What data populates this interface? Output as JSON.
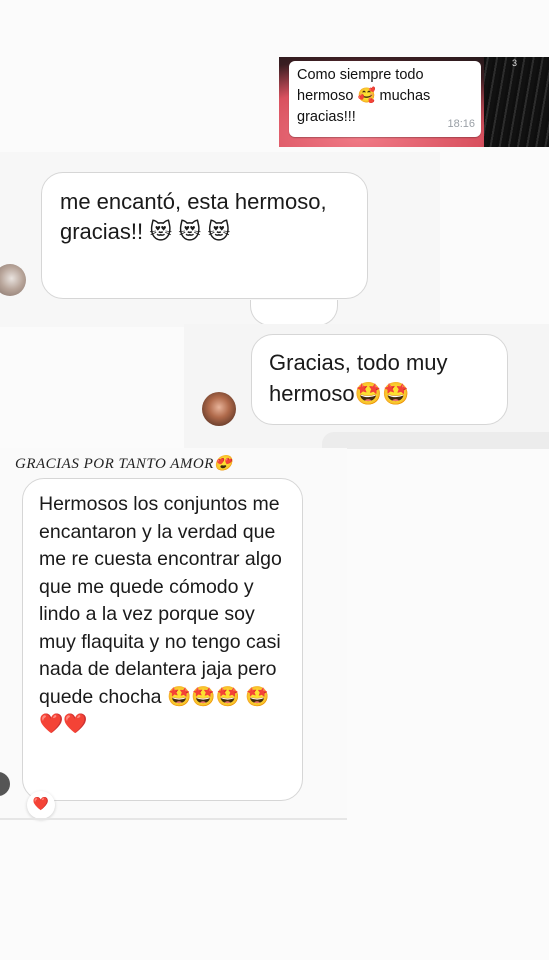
{
  "whatsapp_clip": {
    "text": "Como siempre todo hermoso 🥰 muchas gracias!!!",
    "time": "18:16",
    "corner_mark": "3"
  },
  "message_1": {
    "text": "me encantó, esta hermoso, gracias!! 😻 😻 😻"
  },
  "message_2": {
    "text": "Gracias, todo muy hermoso🤩🤩"
  },
  "caption": {
    "text": "GRACIAS POR TANTO AMOR😍"
  },
  "message_3": {
    "text": "Hermosos los conjuntos me encantaron y la verdad que me re cuesta encontrar algo que me quede cómodo y lindo a la vez porque soy muy flaquita y no tengo casi nada de delantera jaja pero quede chocha 🤩🤩🤩 🤩❤️❤️",
    "reaction": "❤️"
  },
  "colors": {
    "background": "#fbfbfb",
    "bubble_border": "#d6d6d6",
    "whatsapp_bubble": "#ffffff",
    "timestamp": "#9aa0a6",
    "photo_pink": "#e7606e"
  }
}
